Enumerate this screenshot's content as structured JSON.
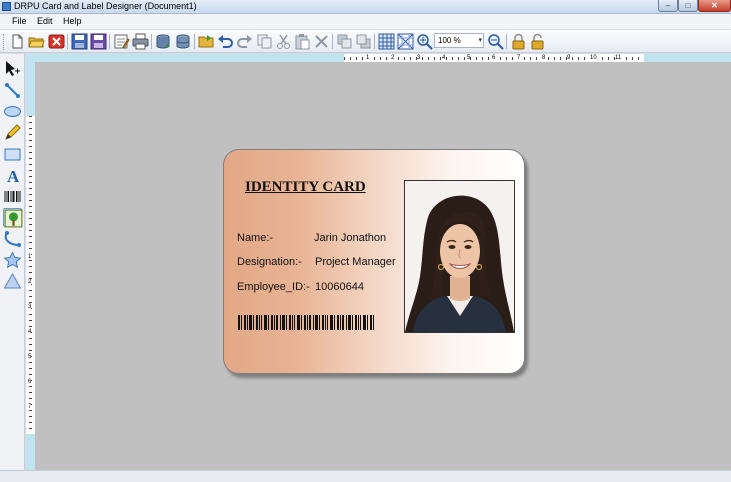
{
  "window": {
    "title": "DRPU Card and Label Designer  (Document1)",
    "controls": {
      "minimize": "‒",
      "maximize": "□",
      "close": "✕"
    }
  },
  "menu": {
    "items": [
      "File",
      "Edit",
      "Help"
    ]
  },
  "toolbar": {
    "zoom_value": "100 %",
    "buttons": [
      "new-icon",
      "open-icon",
      "close-doc-icon",
      "save-icon",
      "save-as-icon",
      "properties-icon",
      "print-icon",
      "database-icon",
      "database-list-icon",
      "open-folder-icon",
      "undo-icon",
      "redo-icon",
      "copy-icon",
      "cut-icon",
      "paste-icon",
      "delete-icon",
      "bring-front-icon",
      "send-back-icon",
      "grid-icon",
      "snap-grid-icon",
      "zoom-in-icon",
      "zoom-out-icon",
      "lock-icon",
      "unlock-icon"
    ]
  },
  "tools": [
    "pointer-tool-icon",
    "line-tool-icon",
    "ellipse-tool-icon",
    "pencil-tool-icon",
    "rectangle-tool-icon",
    "text-tool-icon",
    "barcode-tool-icon",
    "image-tool-icon",
    "curve-tool-icon",
    "star-tool-icon",
    "triangle-tool-icon"
  ],
  "ruler": {
    "top_numbers": [
      "1",
      "2",
      "3",
      "4",
      "5",
      "6",
      "7",
      "8",
      "9",
      "10",
      "11"
    ],
    "left_numbers": [
      "1",
      "2",
      "3",
      "4",
      "5",
      "6",
      "7"
    ]
  },
  "card": {
    "title": "IDENTITY CARD",
    "fields": [
      {
        "label": "Name:-",
        "value": "Jarin Jonathon"
      },
      {
        "label": "Designation:-",
        "value": "Project Manager"
      },
      {
        "label": "Employee_ID:-",
        "value": "10060644"
      }
    ],
    "gradient_colors": [
      "#e2a886",
      "#ffffff"
    ]
  }
}
